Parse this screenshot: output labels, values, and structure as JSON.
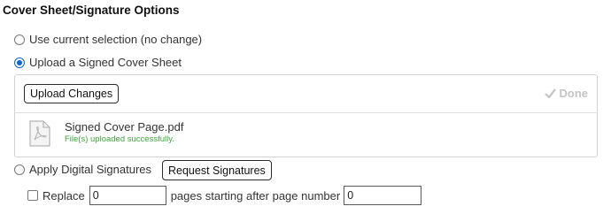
{
  "section": {
    "title": "Cover Sheet/Signature Options"
  },
  "options": {
    "use_current": "Use current selection (no change)",
    "upload_signed": "Upload a Signed Cover Sheet",
    "apply_digital": "Apply Digital Signatures"
  },
  "upload_panel": {
    "upload_button": "Upload Changes",
    "done_label": "Done",
    "file_name": "Signed Cover Page.pdf",
    "file_status": "File(s) uploaded successfully."
  },
  "request_button": "Request Signatures",
  "replace": {
    "label": "Replace",
    "count_value": "0",
    "middle_text": "pages starting after page number",
    "after_page_value": "0"
  },
  "colors": {
    "accent": "#0a64d6",
    "success": "#3aa63a",
    "disabled": "#c4c4c4"
  }
}
